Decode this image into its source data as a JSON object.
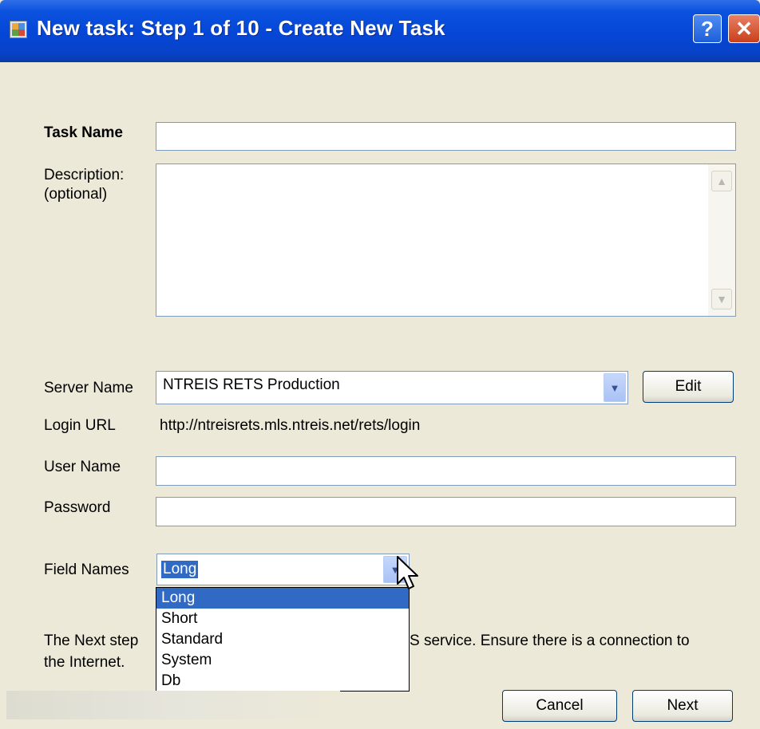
{
  "window": {
    "title": "New task: Step 1 of 10 - Create New Task",
    "help_glyph": "?",
    "close_glyph": "✕"
  },
  "form": {
    "task_name": {
      "label": "Task Name",
      "value": ""
    },
    "description": {
      "label_line1": "Description:",
      "label_line2": "(optional)",
      "value": ""
    },
    "server_name": {
      "label": "Server Name",
      "value": "NTREIS RETS Production",
      "edit_label": "Edit"
    },
    "login_url": {
      "label": "Login URL",
      "value": "http://ntreisrets.mls.ntreis.net/rets/login"
    },
    "user_name": {
      "label": "User Name",
      "value": ""
    },
    "password": {
      "label": "Password",
      "value": ""
    },
    "field_names": {
      "label": "Field Names",
      "selected": "Long",
      "options": [
        "Long",
        "Short",
        "Standard",
        "System",
        "Db"
      ]
    }
  },
  "info": {
    "line1_start": "The Next step",
    "line1_end": "S service. Ensure there is a connection to",
    "line2": "the Internet."
  },
  "buttons": {
    "cancel": "Cancel",
    "next": "Next"
  },
  "colors": {
    "titlebar": "#0546d6",
    "selection": "#316ac5",
    "dialog_bg": "#ece9d8"
  }
}
